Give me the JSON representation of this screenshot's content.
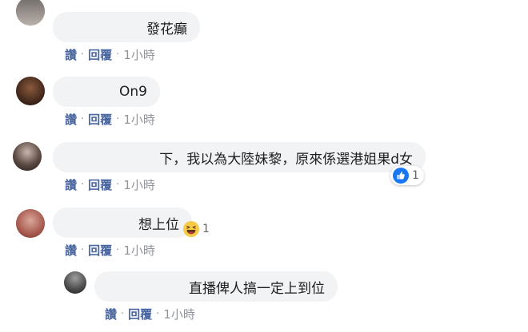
{
  "comments": [
    {
      "text": "發花癲",
      "actions": {
        "like": "讚",
        "reply": "回覆",
        "sep": "·",
        "time": "1小時"
      }
    },
    {
      "text": "On9",
      "actions": {
        "like": "讚",
        "reply": "回覆",
        "sep": "·",
        "time": "1小時"
      }
    },
    {
      "text": "下，我以為大陸妹黎，原來係選港姐果d女",
      "actions": {
        "like": "讚",
        "reply": "回覆",
        "sep": "·",
        "time": "1小時"
      },
      "reaction": {
        "icon": "like-icon",
        "count": "1"
      }
    },
    {
      "text": "想上位",
      "actions": {
        "like": "讚",
        "reply": "回覆",
        "sep": "·",
        "time": "1小時"
      },
      "reaction": {
        "icon": "haha-icon",
        "count": "1"
      }
    },
    {
      "text": "直播俾人搞一定上到位",
      "actions": {
        "like": "讚",
        "reply": "回覆",
        "sep": "·",
        "time": "1小時"
      }
    }
  ],
  "colors": {
    "bubble": "#f2f3f5",
    "link": "#4b67a1",
    "meta": "#90949c",
    "like_blue": "#1877f2",
    "haha_yellow": "#f7c948"
  }
}
